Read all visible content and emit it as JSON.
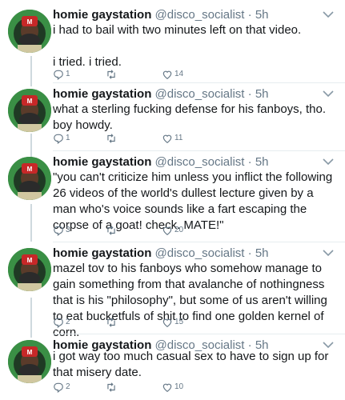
{
  "tweets": [
    {
      "name": "homie gaystation",
      "handle": "@disco_socialist",
      "sep": "·",
      "time": "5h",
      "text": "i had to bail with two minutes left on that video.\n\ni tried. i tried.",
      "replies": "1",
      "retweets": "",
      "likes": "14"
    },
    {
      "name": "homie gaystation",
      "handle": "@disco_socialist",
      "sep": "·",
      "time": "5h",
      "text": "what a sterling fucking defense for his fanboys, tho. boy howdy.",
      "replies": "1",
      "retweets": "",
      "likes": "11"
    },
    {
      "name": "homie gaystation",
      "handle": "@disco_socialist",
      "sep": "·",
      "time": "5h",
      "text": "\"you can't criticize him unless you inflict the following 26 videos of the world's dullest lecture given by a man who's voice sounds like a fart escaping the corpse of a goat! check. MATE!\"",
      "replies": "3",
      "retweets": "",
      "likes": "20"
    },
    {
      "name": "homie gaystation",
      "handle": "@disco_socialist",
      "sep": "·",
      "time": "5h",
      "text": "mazel tov to his fanboys who somehow manage to gain something from that avalanche of nothingness that is his \"philosophy\", but some of us aren't willing to eat bucketfuls of shit to find one golden kernel of corn.",
      "replies": "2",
      "retweets": "",
      "likes": "15"
    },
    {
      "name": "homie gaystation",
      "handle": "@disco_socialist",
      "sep": "·",
      "time": "5h",
      "text": "i got way too much casual sex to have to sign up for that misery date.",
      "replies": "2",
      "retweets": "",
      "likes": "10"
    }
  ],
  "icons": {
    "reply": "reply-icon",
    "retweet": "retweet-icon",
    "like": "heart-icon",
    "more": "chevron-down-icon"
  },
  "colors": {
    "text": "#14171a",
    "muted": "#657786",
    "thread": "#cfd9de",
    "divider": "#e6ecf0"
  }
}
